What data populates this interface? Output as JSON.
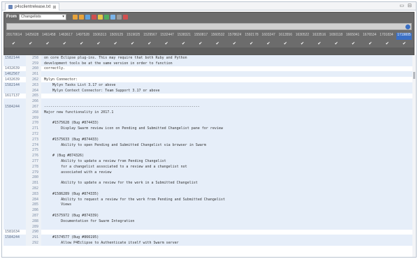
{
  "tab": {
    "label": "p4sclientrelease.txt",
    "close": "⊠"
  },
  "window": {
    "minimize": "▭",
    "maximize": "⊟"
  },
  "toolbar": {
    "from_label": "From",
    "stream_value": "Changelists",
    "icons": [
      {
        "name": "back-icon",
        "color": "#e8a33b"
      },
      {
        "name": "forward-icon",
        "color": "#e8a33b"
      },
      {
        "name": "refresh-icon",
        "color": "#5fa3e0"
      },
      {
        "name": "filter-icon",
        "color": "#d24f4f"
      },
      {
        "name": "diff-icon",
        "color": "#e6c84a"
      },
      {
        "name": "blame-icon",
        "color": "#4fae5f"
      },
      {
        "name": "history-icon",
        "color": "#7ab3e8"
      },
      {
        "name": "settings-icon",
        "color": "#9b9b9b"
      },
      {
        "name": "remove-icon",
        "color": "#d24f4f"
      }
    ],
    "columns": [
      "20170614",
      "1425628",
      "1461458",
      "1463617",
      "1497528",
      "1506313",
      "1509125",
      "1519025",
      "1529567",
      "1532447",
      "1538321",
      "1550817",
      "1560532",
      "1578624",
      "1592178",
      "1603247",
      "1613556",
      "1630522",
      "1633516",
      "1650118",
      "1665041",
      "1676534",
      "1701834",
      "1719005"
    ],
    "active_column": "1719005",
    "check": "✔"
  },
  "editor": {
    "rows": [
      {
        "blame": "1582144",
        "num": "258",
        "text": "on core Eclipse plug-ins. This may require that both Ruby and Python",
        "hl": true
      },
      {
        "blame": "",
        "num": "259",
        "text": "development tools be at the same version in order to function",
        "hl": true
      },
      {
        "blame": "1432639",
        "num": "260",
        "text": "correctly.",
        "hl": false
      },
      {
        "blame": "1462567",
        "num": "261",
        "text": "",
        "hl": true
      },
      {
        "blame": "1432639",
        "num": "262",
        "text": "Mylyn Connector:",
        "hl": false
      },
      {
        "blame": "1582144",
        "num": "263",
        "text": "    Mylyn Tasks List 3.17 or above",
        "hl": true
      },
      {
        "blame": "",
        "num": "264",
        "text": "    Mylyn Context Connector: Team Support 3.17 or above",
        "hl": true
      },
      {
        "blame": "1617137",
        "num": "265",
        "text": "",
        "hl": false
      },
      {
        "blame": "",
        "num": "266",
        "text": "",
        "hl": true
      },
      {
        "blame": "1584244",
        "num": "267",
        "text": "--------------------------------------------------------------------------",
        "hl": true
      },
      {
        "blame": "",
        "num": "268",
        "text": "Major new functionality in 2017.1",
        "hl": true
      },
      {
        "blame": "",
        "num": "269",
        "text": "",
        "hl": true
      },
      {
        "blame": "",
        "num": "270",
        "text": "    #1575628 (Bug #874433)",
        "hl": true
      },
      {
        "blame": "",
        "num": "271",
        "text": "        Display Swarm review icon on Pending and Submitted Changelist pane for review",
        "hl": true
      },
      {
        "blame": "",
        "num": "272",
        "text": "",
        "hl": true
      },
      {
        "blame": "",
        "num": "273",
        "text": "    #1575633 (Bug #874433)",
        "hl": true
      },
      {
        "blame": "",
        "num": "274",
        "text": "        Ability to open Pending and Submitted Changelist via browser in Swarm",
        "hl": true
      },
      {
        "blame": "",
        "num": "275",
        "text": "",
        "hl": true
      },
      {
        "blame": "",
        "num": "276",
        "text": "    # (Bug #874326)",
        "hl": true
      },
      {
        "blame": "",
        "num": "277",
        "text": "        Ability to update a review from Pending Changelist",
        "hl": true
      },
      {
        "blame": "",
        "num": "278",
        "text": "        for a changelist associated to a review and a changelist not",
        "hl": true
      },
      {
        "blame": "",
        "num": "279",
        "text": "        associated with a review",
        "hl": true
      },
      {
        "blame": "",
        "num": "280",
        "text": "",
        "hl": true
      },
      {
        "blame": "",
        "num": "281",
        "text": "        Ability to update a review for the work in a Submitted Changelist",
        "hl": true
      },
      {
        "blame": "",
        "num": "282",
        "text": "",
        "hl": true
      },
      {
        "blame": "",
        "num": "283",
        "text": "    #1586289 (Bug #874335)",
        "hl": true
      },
      {
        "blame": "",
        "num": "284",
        "text": "        Ability to request a review for the work from Pending and Submitted Changelist",
        "hl": true
      },
      {
        "blame": "",
        "num": "285",
        "text": "        Views",
        "hl": true
      },
      {
        "blame": "",
        "num": "286",
        "text": "",
        "hl": true
      },
      {
        "blame": "",
        "num": "287",
        "text": "    #1575972 (Bug #874339)",
        "hl": true
      },
      {
        "blame": "",
        "num": "288",
        "text": "        Documentation for Swarm Integration",
        "hl": true
      },
      {
        "blame": "",
        "num": "289",
        "text": "",
        "hl": true
      },
      {
        "blame": "1581634",
        "num": "290",
        "text": "",
        "hl": false
      },
      {
        "blame": "1584244",
        "num": "291",
        "text": "    #1574577 (Bug #866195)",
        "hl": true
      },
      {
        "blame": "",
        "num": "292",
        "text": "        Allow P4Eclipse to Authenticate itself with Swarm server",
        "hl": true
      }
    ]
  }
}
